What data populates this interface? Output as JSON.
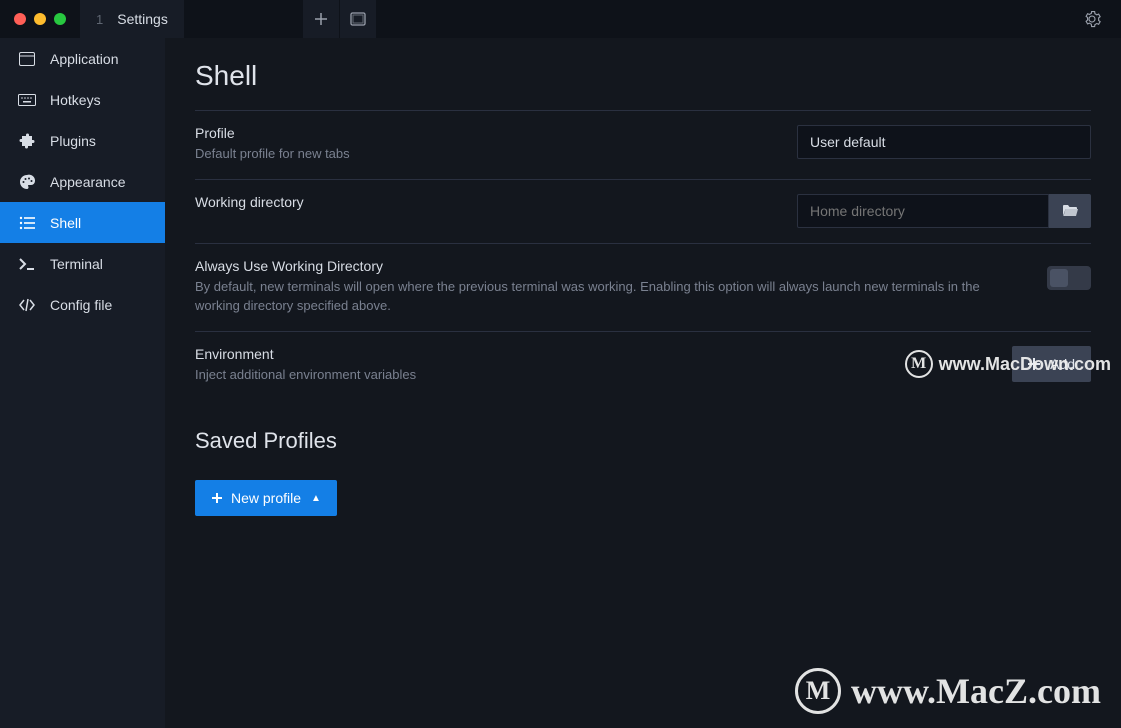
{
  "titlebar": {
    "tab_number": "1",
    "tab_label": "Settings"
  },
  "sidebar": {
    "items": [
      {
        "label": "Application"
      },
      {
        "label": "Hotkeys"
      },
      {
        "label": "Plugins"
      },
      {
        "label": "Appearance"
      },
      {
        "label": "Shell"
      },
      {
        "label": "Terminal"
      },
      {
        "label": "Config file"
      }
    ]
  },
  "main": {
    "title": "Shell",
    "profile": {
      "label": "Profile",
      "desc": "Default profile for new tabs",
      "value": "User default"
    },
    "workdir": {
      "label": "Working directory",
      "placeholder": "Home directory"
    },
    "alwaysUse": {
      "label": "Always Use Working Directory",
      "desc": "By default, new terminals will open where the previous terminal was working. Enabling this option will always launch new terminals in the working directory specified above."
    },
    "env": {
      "label": "Environment",
      "desc": "Inject additional environment variables",
      "add_btn": "Add"
    },
    "saved_profiles_title": "Saved Profiles",
    "new_profile_btn": "New profile"
  },
  "watermarks": {
    "w1": "www.MacDown.com",
    "w2": "www.MacZ.com"
  }
}
